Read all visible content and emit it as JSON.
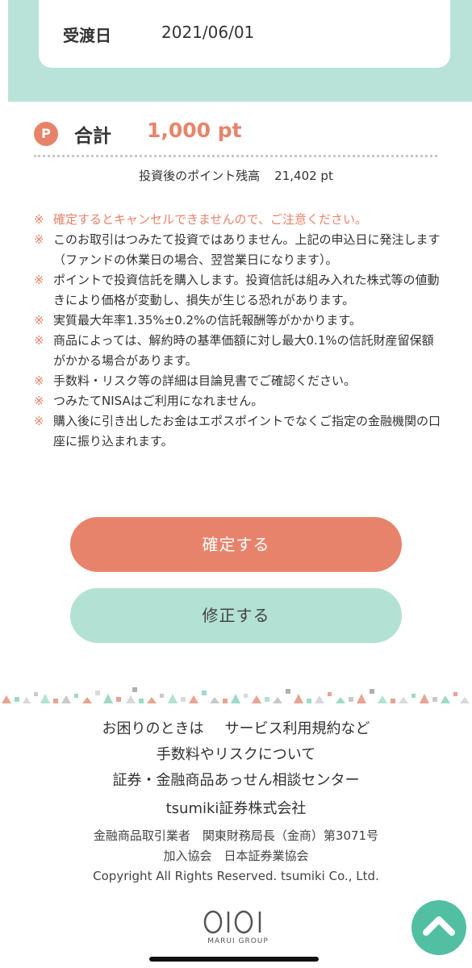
{
  "detail": {
    "label": "受渡日",
    "value": "2021/06/01"
  },
  "total": {
    "icon_letter": "P",
    "label": "合計",
    "value": "1,000 pt"
  },
  "balance": {
    "label": "投資後のポイント残高",
    "value": "21,402 pt"
  },
  "notes": [
    {
      "mark": "※",
      "text": "確定するとキャンセルできませんので、ご注意ください。"
    },
    {
      "mark": "※",
      "text": "このお取引はつみたて投資ではありません。上記の申込日に発注します（ファンドの休業日の場合、翌営業日になります）。"
    },
    {
      "mark": "※",
      "text": "ポイントで投資信託を購入します。投資信託は組み入れた株式等の値動きにより価格が変動し、損失が生じる恐れがあります。"
    },
    {
      "mark": "※",
      "text": "実質最大年率1.35%±0.2%の信託報酬等がかかります。"
    },
    {
      "mark": "※",
      "text": "商品によっては、解約時の基準価額に対し最大0.1%の信託財産留保額がかかる場合があります。"
    },
    {
      "mark": "※",
      "text": "手数料・リスク等の詳細は目論見書でご確認ください。"
    },
    {
      "mark": "※",
      "text": "つみたてNISAはご利用になれません。"
    },
    {
      "mark": "※",
      "text": "購入後に引き出したお金はエポスポイントでなくご指定の金融機関の口座に振り込まれます。"
    }
  ],
  "buttons": {
    "confirm": "確定する",
    "edit": "修正する"
  },
  "footer": {
    "link_help": "お困りのときは",
    "link_terms": "サービス利用規約など",
    "link_fees": "手数料やリスクについて",
    "link_center": "証券・金融商品あっせん相談センター",
    "company": "tsumiki証券株式会社",
    "registration": "金融商品取引業者　関東財務局長（金商）第3071号",
    "association": "加入協会　日本証券業協会",
    "copyright": "Copyright All Rights Reserved. tsumiki Co., Ltd."
  },
  "logo": {
    "mark": "OIOI",
    "group": "MARUI GROUP"
  },
  "icons": {
    "to_top": "chevron-up-icon",
    "points": "points-badge-icon"
  },
  "colors": {
    "accent": "#e8836b",
    "mint": "#b3e1d4",
    "mint_band": "#b9e2d8",
    "to_top": "#52bfa3"
  }
}
